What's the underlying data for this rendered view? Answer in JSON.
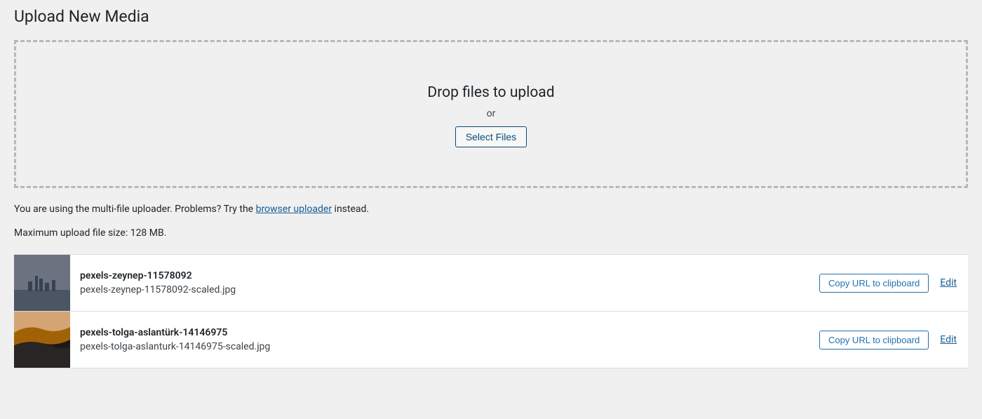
{
  "page_title": "Upload New Media",
  "drop_zone": {
    "title": "Drop files to upload",
    "or": "or",
    "select_button": "Select Files"
  },
  "uploader_note": {
    "prefix": "You are using the multi-file uploader. Problems? Try the ",
    "link_text": "browser uploader",
    "suffix": " instead."
  },
  "max_upload": "Maximum upload file size: 128 MB.",
  "actions": {
    "copy_url": "Copy URL to clipboard",
    "edit": "Edit"
  },
  "media_items": [
    {
      "title": "pexels-zeynep-11578092",
      "filename": "pexels-zeynep-11578092-scaled.jpg"
    },
    {
      "title": "pexels-tolga-aslantürk-14146975",
      "filename": "pexels-tolga-aslanturk-14146975-scaled.jpg"
    }
  ]
}
